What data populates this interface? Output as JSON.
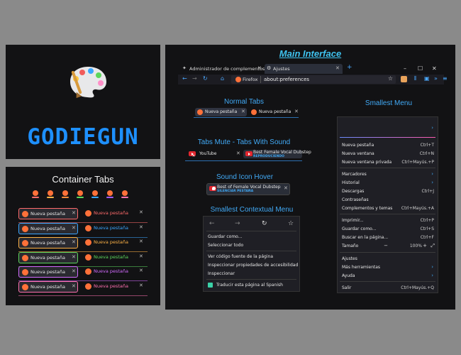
{
  "logo": {
    "text": "GODIEGUN"
  },
  "container_tabs": {
    "title": "Container Tabs",
    "colors": [
      "#ff6b6b",
      "#3aa6ff",
      "#ffb347",
      "#5cd65c",
      "#d36bff",
      "#ff70b0"
    ],
    "icon_colors": [
      "#ff6b6b",
      "#ffb347",
      "#ff8c3a",
      "#5cd65c",
      "#3aa6ff",
      "#a05cff",
      "#ff70b0"
    ],
    "rows": [
      {
        "tab_label": "Nueva pestaña",
        "tab2_label": "Nueva pestaña"
      },
      {
        "tab_label": "Nueva pestaña",
        "tab2_label": "Nueva pestaña"
      },
      {
        "tab_label": "Nueva pestaña",
        "tab2_label": "Nueva pestaña"
      },
      {
        "tab_label": "Nueva pestaña",
        "tab2_label": "Nueva pestaña"
      },
      {
        "tab_label": "Nueva pestaña",
        "tab2_label": "Nueva pestaña"
      },
      {
        "tab_label": "Nueva pestaña",
        "tab2_label": "Nueva pestaña"
      }
    ]
  },
  "main": {
    "title": "Main Interface",
    "tabs": [
      {
        "label": "Administrador de complementos"
      },
      {
        "label": "Ajustes"
      }
    ],
    "url": {
      "identity": "Firefox",
      "value": "about:preferences"
    },
    "normal_tabs": {
      "title": "Normal Tabs",
      "tab1": "Nueva pestaña",
      "tab2": "Nueva pestaña"
    },
    "mute_tabs": {
      "title": "Tabs Mute - Tabs With Sound",
      "tab1": "YouTube",
      "tab2": "Best Female Vocal Dubstep",
      "tab2_sub": "REPRODUCIENDO"
    },
    "sound_hover": {
      "title": "Sound Icon Hover",
      "label": "Best of Female Vocal Dubstep",
      "sub": "SILENCIAR PESTAÑA"
    },
    "ctx_menu": {
      "title": "Smallest Contextual Menu",
      "items": [
        "Guardar como...",
        "Seleccionar todo",
        "Ver código fuente de la página",
        "Inspeccionar propiedades de accesibilidad",
        "Inspeccionar",
        "Traducir esta página al Spanish"
      ]
    },
    "big_menu": {
      "title": "Smallest Menu",
      "items": [
        {
          "label": "Nueva pestaña",
          "shortcut": "Ctrl+T"
        },
        {
          "label": "Nueva ventana",
          "shortcut": "Ctrl+N"
        },
        {
          "label": "Nueva ventana privada",
          "shortcut": "Ctrl+Mayús.+P"
        },
        {
          "label": "Marcadores",
          "shortcut": ""
        },
        {
          "label": "Historial",
          "shortcut": ""
        },
        {
          "label": "Descargas",
          "shortcut": "Ctrl+J"
        },
        {
          "label": "Contraseñas",
          "shortcut": ""
        },
        {
          "label": "Complementos y temas",
          "shortcut": "Ctrl+Mayús.+A"
        },
        {
          "label": "Imprimir...",
          "shortcut": "Ctrl+P"
        },
        {
          "label": "Guardar como...",
          "shortcut": "Ctrl+S"
        },
        {
          "label": "Buscar en la página...",
          "shortcut": "Ctrl+F"
        },
        {
          "label": "Tamaño",
          "shortcut": "100%"
        },
        {
          "label": "Ajustes",
          "shortcut": ""
        },
        {
          "label": "Más herramientas",
          "shortcut": ""
        },
        {
          "label": "Ayuda",
          "shortcut": ""
        },
        {
          "label": "Salir",
          "shortcut": "Ctrl+Mayús.+Q"
        }
      ]
    }
  }
}
